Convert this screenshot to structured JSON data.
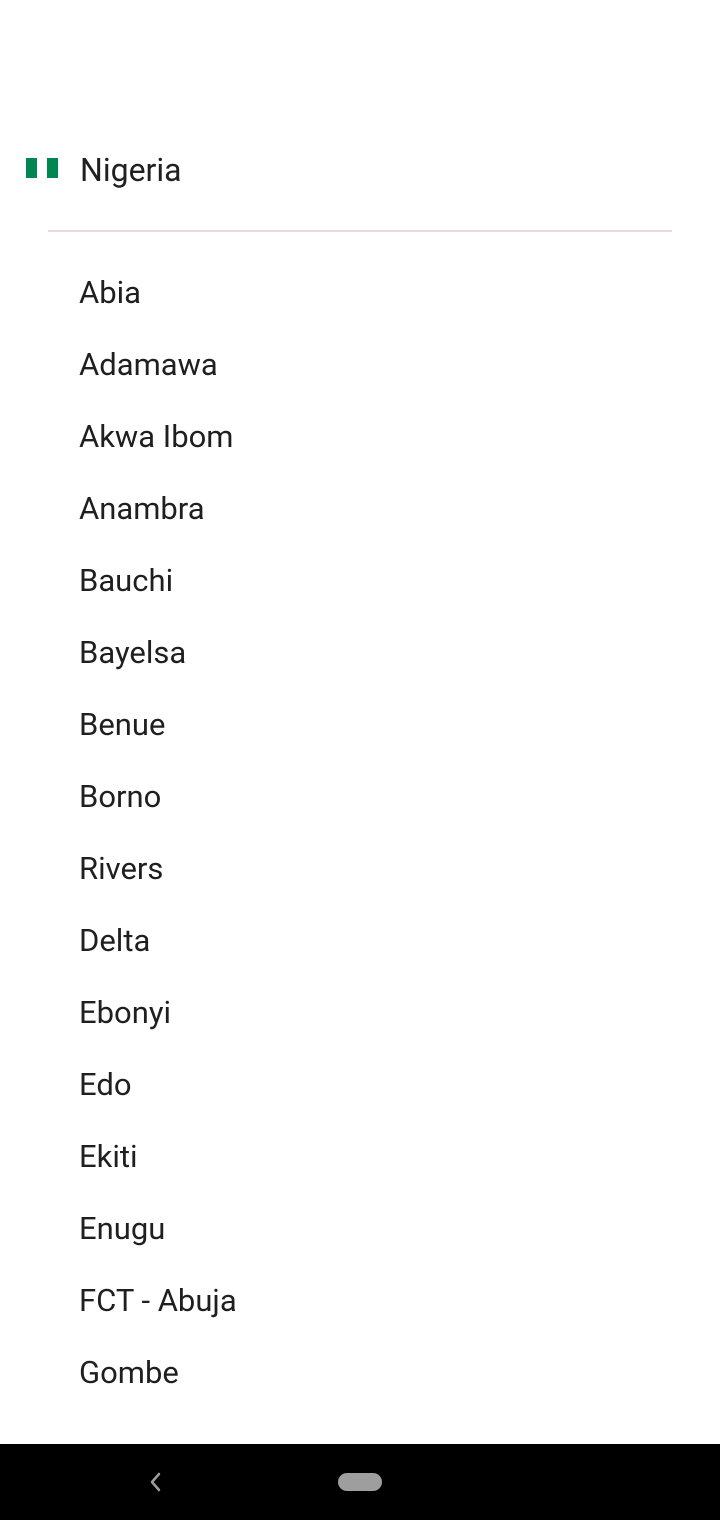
{
  "country": {
    "name": "Nigeria",
    "flag_icon": "nigeria-flag-icon",
    "flag_colors": [
      "#008751",
      "#ffffff",
      "#008751"
    ]
  },
  "states": [
    "Abia",
    "Adamawa",
    "Akwa Ibom",
    "Anambra",
    "Bauchi",
    "Bayelsa",
    "Benue",
    "Borno",
    "Rivers",
    "Delta",
    "Ebonyi",
    "Edo",
    "Ekiti",
    "Enugu",
    "FCT - Abuja",
    "Gombe"
  ],
  "navigation": {
    "back_icon": "chevron-left-icon",
    "home_icon": "home-pill-icon"
  }
}
